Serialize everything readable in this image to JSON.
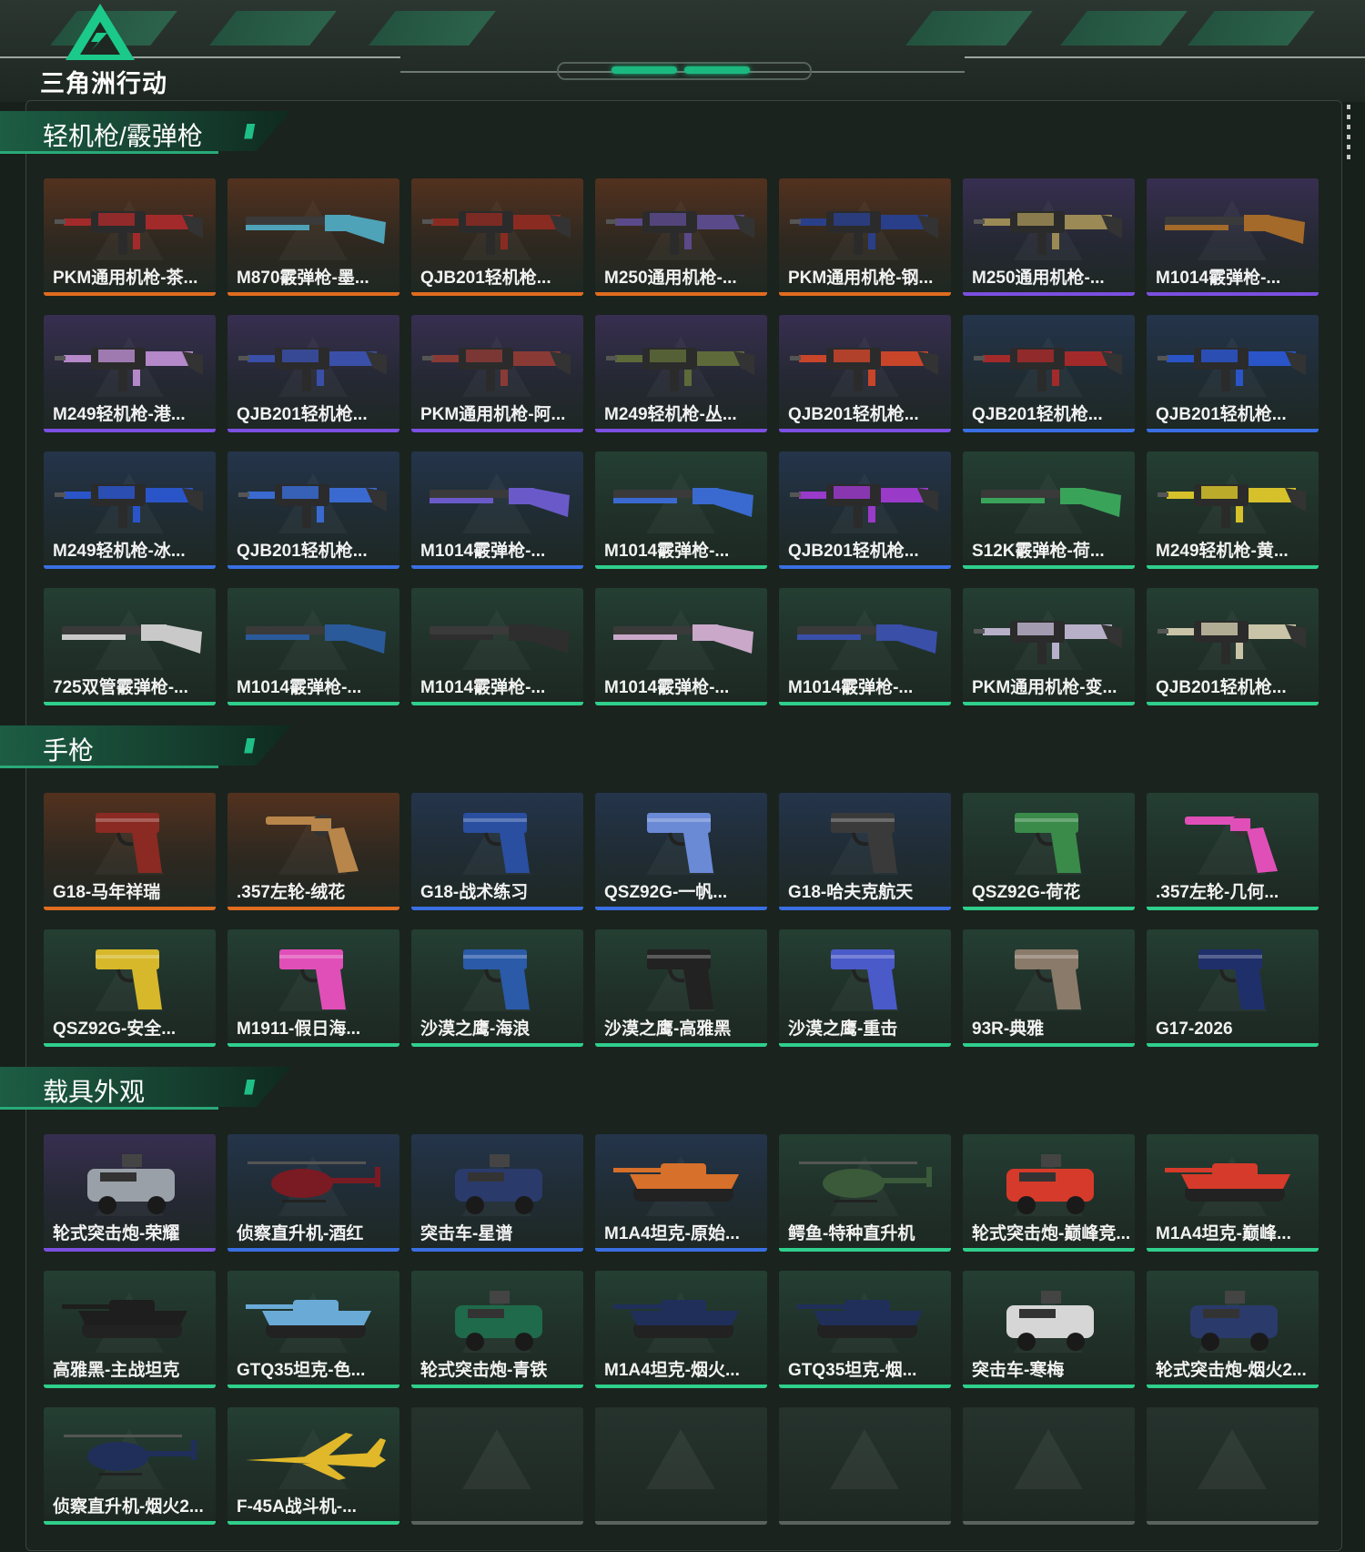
{
  "brand": {
    "name": "三角洲行动"
  },
  "colors": {
    "orange": "#e06c1f",
    "purple": "#7b4fe0",
    "blue": "#3a6fe3",
    "green": "#2fcf8c",
    "empty": "#5b625f",
    "accent": "#1fbf86"
  },
  "sections": [
    {
      "title": "轻机枪/霰弹枪",
      "items": [
        {
          "label": "PKM通用机枪-茶...",
          "rarity": "orange",
          "icon": "machine-gun-icon",
          "tint": "#a32a2a"
        },
        {
          "label": "M870霰弹枪-墨...",
          "rarity": "orange",
          "icon": "shotgun-icon",
          "tint": "#4fa3b8"
        },
        {
          "label": "QJB201轻机枪...",
          "rarity": "orange",
          "icon": "machine-gun-icon",
          "tint": "#8a2b22"
        },
        {
          "label": "M250通用机枪-...",
          "rarity": "orange",
          "icon": "machine-gun-icon",
          "tint": "#5a4a8a"
        },
        {
          "label": "PKM通用机枪-钢...",
          "rarity": "orange",
          "icon": "machine-gun-icon",
          "tint": "#2a3f8a"
        },
        {
          "label": "M250通用机枪-...",
          "rarity": "purple",
          "icon": "machine-gun-icon",
          "tint": "#9b8a55"
        },
        {
          "label": "M1014霰弹枪-...",
          "rarity": "purple",
          "icon": "shotgun-icon",
          "tint": "#a36a2a"
        },
        {
          "label": "M249轻机枪-港...",
          "rarity": "purple",
          "icon": "machine-gun-icon",
          "tint": "#b488c9"
        },
        {
          "label": "QJB201轻机枪...",
          "rarity": "purple",
          "icon": "machine-gun-icon",
          "tint": "#3a4fa8"
        },
        {
          "label": "PKM通用机枪-阿...",
          "rarity": "purple",
          "icon": "machine-gun-icon",
          "tint": "#8a3a35"
        },
        {
          "label": "M249轻机枪-丛...",
          "rarity": "purple",
          "icon": "machine-gun-icon",
          "tint": "#5e6a3a"
        },
        {
          "label": "QJB201轻机枪...",
          "rarity": "purple",
          "icon": "machine-gun-icon",
          "tint": "#c9452a"
        },
        {
          "label": "QJB201轻机枪...",
          "rarity": "blue",
          "icon": "machine-gun-icon",
          "tint": "#a32a2a"
        },
        {
          "label": "QJB201轻机枪...",
          "rarity": "blue",
          "icon": "machine-gun-icon",
          "tint": "#2a55c9"
        },
        {
          "label": "M249轻机枪-冰...",
          "rarity": "blue",
          "icon": "machine-gun-icon",
          "tint": "#2a55c9"
        },
        {
          "label": "QJB201轻机枪...",
          "rarity": "blue",
          "icon": "machine-gun-icon",
          "tint": "#3a6ad0"
        },
        {
          "label": "M1014霰弹枪-...",
          "rarity": "blue",
          "icon": "shotgun-icon",
          "tint": "#6a5ac9"
        },
        {
          "label": "M1014霰弹枪-...",
          "rarity": "green",
          "icon": "shotgun-icon",
          "tint": "#3a6ad0"
        },
        {
          "label": "QJB201轻机枪...",
          "rarity": "blue",
          "icon": "machine-gun-icon",
          "tint": "#9a3ac9"
        },
        {
          "label": "S12K霰弹枪-荷...",
          "rarity": "green",
          "icon": "shotgun-icon",
          "tint": "#3aa35a"
        },
        {
          "label": "M249轻机枪-黄...",
          "rarity": "green",
          "icon": "machine-gun-icon",
          "tint": "#d6c12a"
        },
        {
          "label": "725双管霰弹枪-...",
          "rarity": "green",
          "icon": "shotgun-icon",
          "tint": "#c9c9c9"
        },
        {
          "label": "M1014霰弹枪-...",
          "rarity": "green",
          "icon": "shotgun-icon",
          "tint": "#2a5a9a"
        },
        {
          "label": "M1014霰弹枪-...",
          "rarity": "green",
          "icon": "shotgun-icon",
          "tint": "#2e2e2e"
        },
        {
          "label": "M1014霰弹枪-...",
          "rarity": "green",
          "icon": "shotgun-icon",
          "tint": "#c9a8c9"
        },
        {
          "label": "M1014霰弹枪-...",
          "rarity": "green",
          "icon": "shotgun-icon",
          "tint": "#3a4fa8"
        },
        {
          "label": "PKM通用机枪-变...",
          "rarity": "green",
          "icon": "machine-gun-icon",
          "tint": "#b8b0c9"
        },
        {
          "label": "QJB201轻机枪...",
          "rarity": "green",
          "icon": "machine-gun-icon",
          "tint": "#c9c4a8"
        }
      ]
    },
    {
      "title": "手枪",
      "items": [
        {
          "label": "G18-马年祥瑞",
          "rarity": "orange",
          "icon": "pistol-icon",
          "tint": "#8a2a22"
        },
        {
          "label": ".357左轮-绒花",
          "rarity": "orange",
          "icon": "revolver-icon",
          "tint": "#b8864a"
        },
        {
          "label": "G18-战术练习",
          "rarity": "blue",
          "icon": "pistol-icon",
          "tint": "#2a4fa0"
        },
        {
          "label": "QSZ92G-一帆...",
          "rarity": "blue",
          "icon": "pistol-icon",
          "tint": "#6a8ad6"
        },
        {
          "label": "G18-哈夫克航天",
          "rarity": "blue",
          "icon": "pistol-icon",
          "tint": "#3a3a3a"
        },
        {
          "label": "QSZ92G-荷花",
          "rarity": "green",
          "icon": "pistol-icon",
          "tint": "#3a8a4a"
        },
        {
          "label": ".357左轮-几何...",
          "rarity": "green",
          "icon": "revolver-icon",
          "tint": "#e04fb8"
        },
        {
          "label": "QSZ92G-安全...",
          "rarity": "green",
          "icon": "pistol-icon",
          "tint": "#d6b82a"
        },
        {
          "label": "M1911-假日海...",
          "rarity": "green",
          "icon": "pistol-icon",
          "tint": "#e04fb8"
        },
        {
          "label": "沙漠之鹰-海浪",
          "rarity": "green",
          "icon": "pistol-icon",
          "tint": "#2a5aa8"
        },
        {
          "label": "沙漠之鹰-高雅黑",
          "rarity": "green",
          "icon": "pistol-icon",
          "tint": "#222222"
        },
        {
          "label": "沙漠之鹰-重击",
          "rarity": "green",
          "icon": "pistol-icon",
          "tint": "#4a5ac9"
        },
        {
          "label": "93R-典雅",
          "rarity": "green",
          "icon": "pistol-icon",
          "tint": "#8a7a6a"
        },
        {
          "label": "G17-2026",
          "rarity": "green",
          "icon": "pistol-icon",
          "tint": "#1f2f6a"
        }
      ]
    },
    {
      "title": "载具外观",
      "items": [
        {
          "label": "轮式突击炮-荣耀",
          "rarity": "purple",
          "icon": "armored-car-icon",
          "tint": "#9aa0a8"
        },
        {
          "label": "侦察直升机-酒红",
          "rarity": "blue",
          "icon": "helicopter-icon",
          "tint": "#7a1a22"
        },
        {
          "label": "突击车-星谱",
          "rarity": "blue",
          "icon": "armored-car-icon",
          "tint": "#2a3a6a"
        },
        {
          "label": "M1A4坦克-原始...",
          "rarity": "blue",
          "icon": "tank-icon",
          "tint": "#d6702a"
        },
        {
          "label": "鳄鱼-特种直升机",
          "rarity": "green",
          "icon": "helicopter-icon",
          "tint": "#3a5a3a"
        },
        {
          "label": "轮式突击炮-巅峰竞...",
          "rarity": "green",
          "icon": "armored-car-icon",
          "tint": "#d63a2a"
        },
        {
          "label": "M1A4坦克-巅峰...",
          "rarity": "green",
          "icon": "tank-icon",
          "tint": "#d63a2a"
        },
        {
          "label": "高雅黑-主战坦克",
          "rarity": "green",
          "icon": "tank-icon",
          "tint": "#1e1e1e"
        },
        {
          "label": "GTQ35坦克-色...",
          "rarity": "green",
          "icon": "tank-icon",
          "tint": "#6aaad6"
        },
        {
          "label": "轮式突击炮-青铁",
          "rarity": "green",
          "icon": "armored-car-icon",
          "tint": "#1f6a4a"
        },
        {
          "label": "M1A4坦克-烟火...",
          "rarity": "green",
          "icon": "tank-icon",
          "tint": "#1f2f5a"
        },
        {
          "label": "GTQ35坦克-烟...",
          "rarity": "green",
          "icon": "tank-icon",
          "tint": "#1f2f5a"
        },
        {
          "label": "突击车-寒梅",
          "rarity": "green",
          "icon": "armored-car-icon",
          "tint": "#d6d6d6"
        },
        {
          "label": "轮式突击炮-烟火2...",
          "rarity": "green",
          "icon": "armored-car-icon",
          "tint": "#2a3a6a"
        },
        {
          "label": "侦察直升机-烟火2...",
          "rarity": "green",
          "icon": "helicopter-icon",
          "tint": "#1f2f5a"
        },
        {
          "label": "F-45A战斗机-...",
          "rarity": "green",
          "icon": "jet-icon",
          "tint": "#e0b82a"
        },
        {
          "label": "",
          "rarity": "empty",
          "icon": "",
          "tint": ""
        },
        {
          "label": "",
          "rarity": "empty",
          "icon": "",
          "tint": ""
        },
        {
          "label": "",
          "rarity": "empty",
          "icon": "",
          "tint": ""
        },
        {
          "label": "",
          "rarity": "empty",
          "icon": "",
          "tint": ""
        },
        {
          "label": "",
          "rarity": "empty",
          "icon": "",
          "tint": ""
        }
      ]
    }
  ]
}
